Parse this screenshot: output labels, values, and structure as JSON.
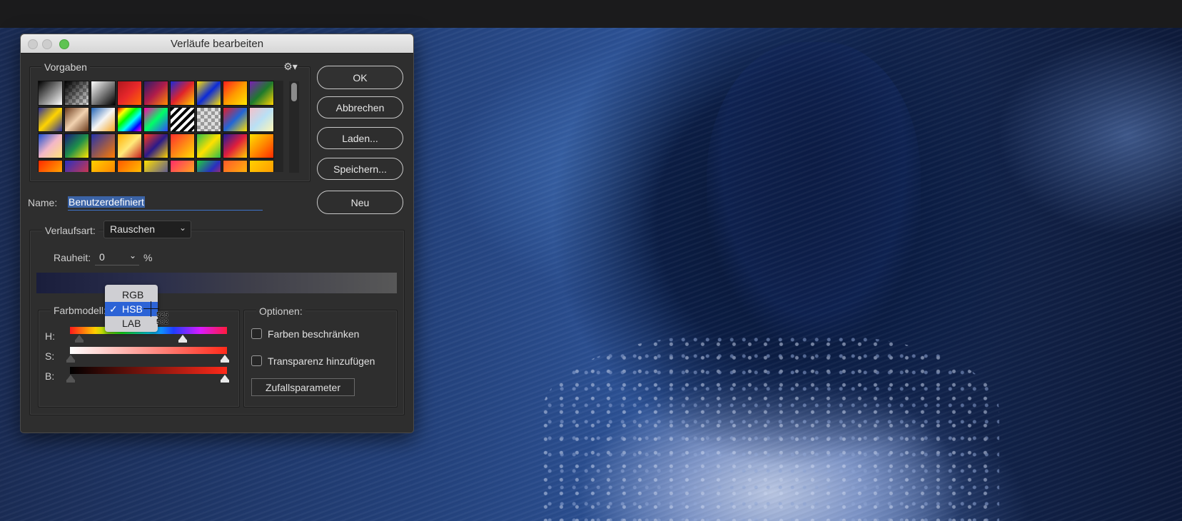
{
  "dialog": {
    "title": "Verläufe bearbeiten",
    "presets_label": "Vorgaben",
    "gear_icon": "gear-icon",
    "buttons": {
      "ok": "OK",
      "cancel": "Abbrechen",
      "load": "Laden...",
      "save": "Speichern...",
      "new": "Neu"
    },
    "name_label": "Name:",
    "name_value": "Benutzerdefiniert",
    "gradient_type_label": "Verlaufsart:",
    "gradient_type_value": "Rauschen",
    "roughness_label": "Rauheit:",
    "roughness_value": "0",
    "roughness_unit": "%",
    "color_model_label": "Farbmodell:",
    "color_model_options": [
      "RGB",
      "HSB",
      "LAB"
    ],
    "color_model_selected": "HSB",
    "checkmark": "✓",
    "cursor_readout": [
      "525",
      "582"
    ],
    "channels": {
      "h": "H:",
      "s": "S:",
      "b": "B:"
    },
    "channel_stops": {
      "h": [
        0.05,
        0.72
      ],
      "s": [
        0.0,
        1.0
      ],
      "b": [
        0.0,
        1.0
      ]
    },
    "options_label": "Optionen:",
    "option_restrict_colors": "Farben beschränken",
    "option_add_transparency": "Transparenz hinzufügen",
    "randomize_button": "Zufallsparameter",
    "chevron_icon": "chevron-down-icon"
  },
  "colors": {
    "selection_blue": "#3b63a6",
    "popup_highlight": "#2c63d6",
    "zoom_green": "#5fc353"
  }
}
